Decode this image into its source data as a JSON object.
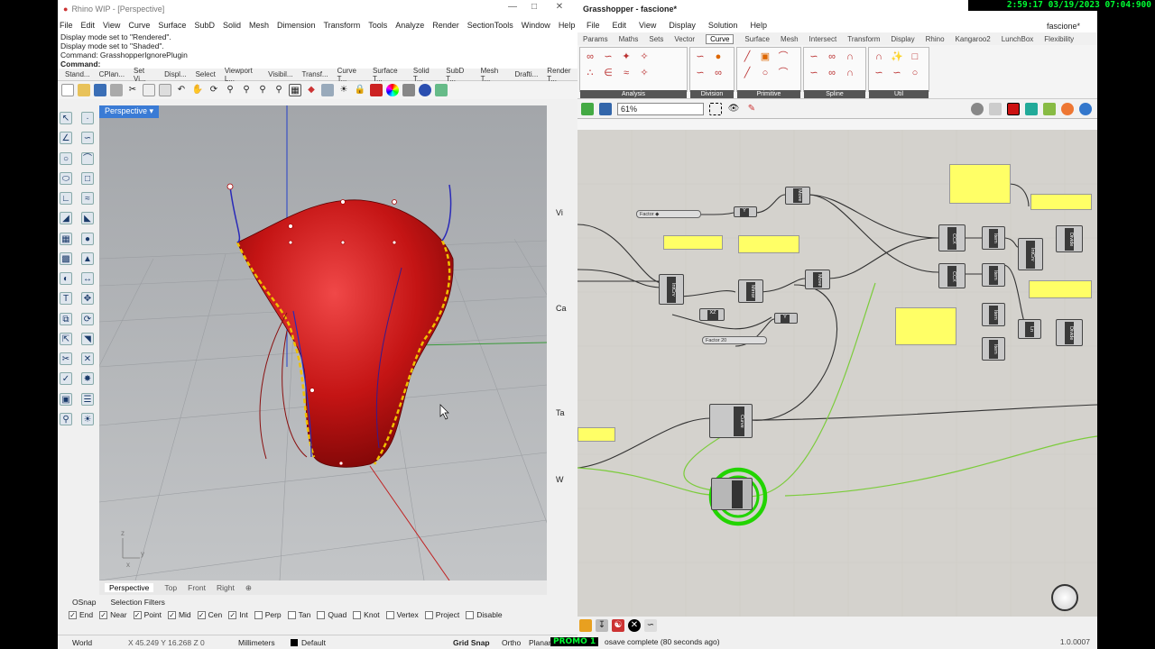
{
  "clock": "2:59:17  03/19/2023 07:04:900",
  "rhino": {
    "title": "Rhino WIP - [Perspective]",
    "menu": [
      "File",
      "Edit",
      "View",
      "Curve",
      "Surface",
      "SubD",
      "Solid",
      "Mesh",
      "Dimension",
      "Transform",
      "Tools",
      "Analyze",
      "Render",
      "SectionTools",
      "Window",
      "Help"
    ],
    "history": [
      "Display mode set to \"Rendered\".",
      "Display mode set to \"Shaded\".",
      "Command: GrasshopperIgnorePlugin"
    ],
    "command_label": "Command:",
    "toolbar_tabs": [
      "Stand...",
      "CPlan...",
      "Set Vi...",
      "Displ...",
      "Select",
      "Viewport L...",
      "Visibil...",
      "Transf...",
      "Curve T...",
      "Surface T...",
      "Solid T...",
      "SubD T...",
      "Mesh T...",
      "Drafti...",
      "Render T..."
    ],
    "viewport_label": "Perspective",
    "side_labels": [
      "Vi",
      "Ca",
      "Ta",
      "W"
    ],
    "view_tabs": [
      "Perspective",
      "Top",
      "Front",
      "Right",
      "⊕"
    ],
    "osnap_tabs": [
      "OSnap",
      "Selection Filters"
    ],
    "osnaps": [
      {
        "label": "End",
        "checked": true
      },
      {
        "label": "Near",
        "checked": true
      },
      {
        "label": "Point",
        "checked": true
      },
      {
        "label": "Mid",
        "checked": true
      },
      {
        "label": "Cen",
        "checked": true
      },
      {
        "label": "Int",
        "checked": true
      },
      {
        "label": "Perp",
        "checked": false
      },
      {
        "label": "Tan",
        "checked": false
      },
      {
        "label": "Quad",
        "checked": false
      },
      {
        "label": "Knot",
        "checked": false
      },
      {
        "label": "Vertex",
        "checked": false
      },
      {
        "label": "Project",
        "checked": false
      },
      {
        "label": "Disable",
        "checked": false
      }
    ],
    "status": {
      "cplane": "World",
      "coords": "X 45.249  Y 16.268  Z 0",
      "units": "Millimeters",
      "layer": "Default",
      "grid_snap": "Grid Snap",
      "ortho": "Ortho",
      "planar": "Planar"
    }
  },
  "gh": {
    "title": "Grasshopper - fascione*",
    "doc_name": "fascione*",
    "menu": [
      "File",
      "Edit",
      "View",
      "Display",
      "Solution",
      "Help"
    ],
    "tabs": [
      "Params",
      "Maths",
      "Sets",
      "Vector",
      "Curve",
      "Surface",
      "Mesh",
      "Intersect",
      "Transform",
      "Display",
      "Rhino",
      "Kangaroo2",
      "LunchBox",
      "Flexibility"
    ],
    "active_tab": "Curve",
    "ribbon_groups": [
      "Analysis",
      "Division",
      "Primitive",
      "Spline",
      "Util"
    ],
    "zoom": "61%",
    "components": [
      {
        "label": "Move"
      },
      {
        "label": "Y"
      },
      {
        "label": "IntCrv"
      },
      {
        "label": "Mirror"
      },
      {
        "label": "Move"
      },
      {
        "label": "XZ"
      },
      {
        "label": "Y"
      },
      {
        "label": "CCX"
      },
      {
        "label": "Item"
      },
      {
        "label": "IntCrv"
      },
      {
        "label": "Divide"
      },
      {
        "label": "CCX"
      },
      {
        "label": "Item"
      },
      {
        "label": "Item"
      },
      {
        "label": "Ln"
      },
      {
        "label": "Divide"
      },
      {
        "label": "Item"
      },
      {
        "label": "Curve"
      }
    ],
    "sliders": [
      {
        "label": "Factor",
        "value": "◆"
      },
      {
        "label": "Factor",
        "value": "20"
      }
    ],
    "status_text": "osave complete (80 seconds ago)",
    "version": "1.0.0007"
  },
  "promo": "PROMO 1"
}
